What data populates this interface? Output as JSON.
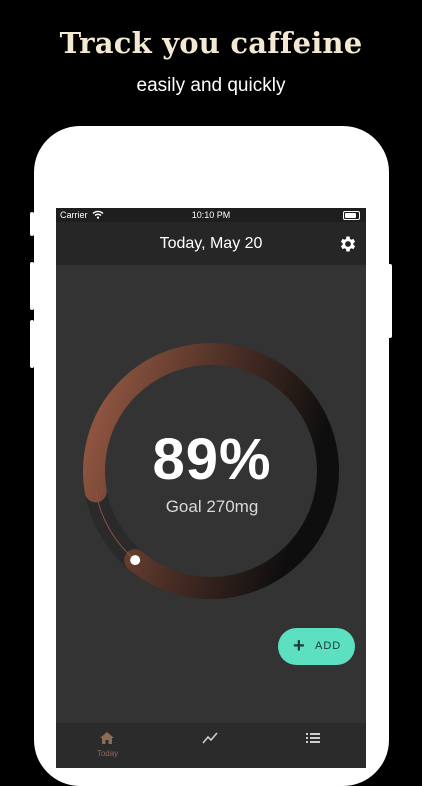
{
  "promo": {
    "title": "Track you caffeine",
    "subtitle": "easily and quickly"
  },
  "status_bar": {
    "carrier": "Carrier",
    "time": "10:10 PM"
  },
  "header": {
    "title": "Today, May 20",
    "settings_icon": "gear-icon"
  },
  "progress": {
    "percent_label": "89%",
    "percent_value": 89,
    "goal_label": "Goal 270mg"
  },
  "add_button": {
    "icon": "plus-icon",
    "label": "ADD",
    "color": "#5de0c2"
  },
  "tabbar": {
    "items": [
      {
        "icon": "home-icon",
        "label": "Today"
      },
      {
        "icon": "chart-icon",
        "label": ""
      },
      {
        "icon": "list-icon",
        "label": ""
      }
    ]
  },
  "colors": {
    "background": "#000000",
    "screen": "#333333",
    "ring_start": "#9a5b45",
    "ring_end": "#0e0e0e",
    "accent": "#5de0c2"
  }
}
